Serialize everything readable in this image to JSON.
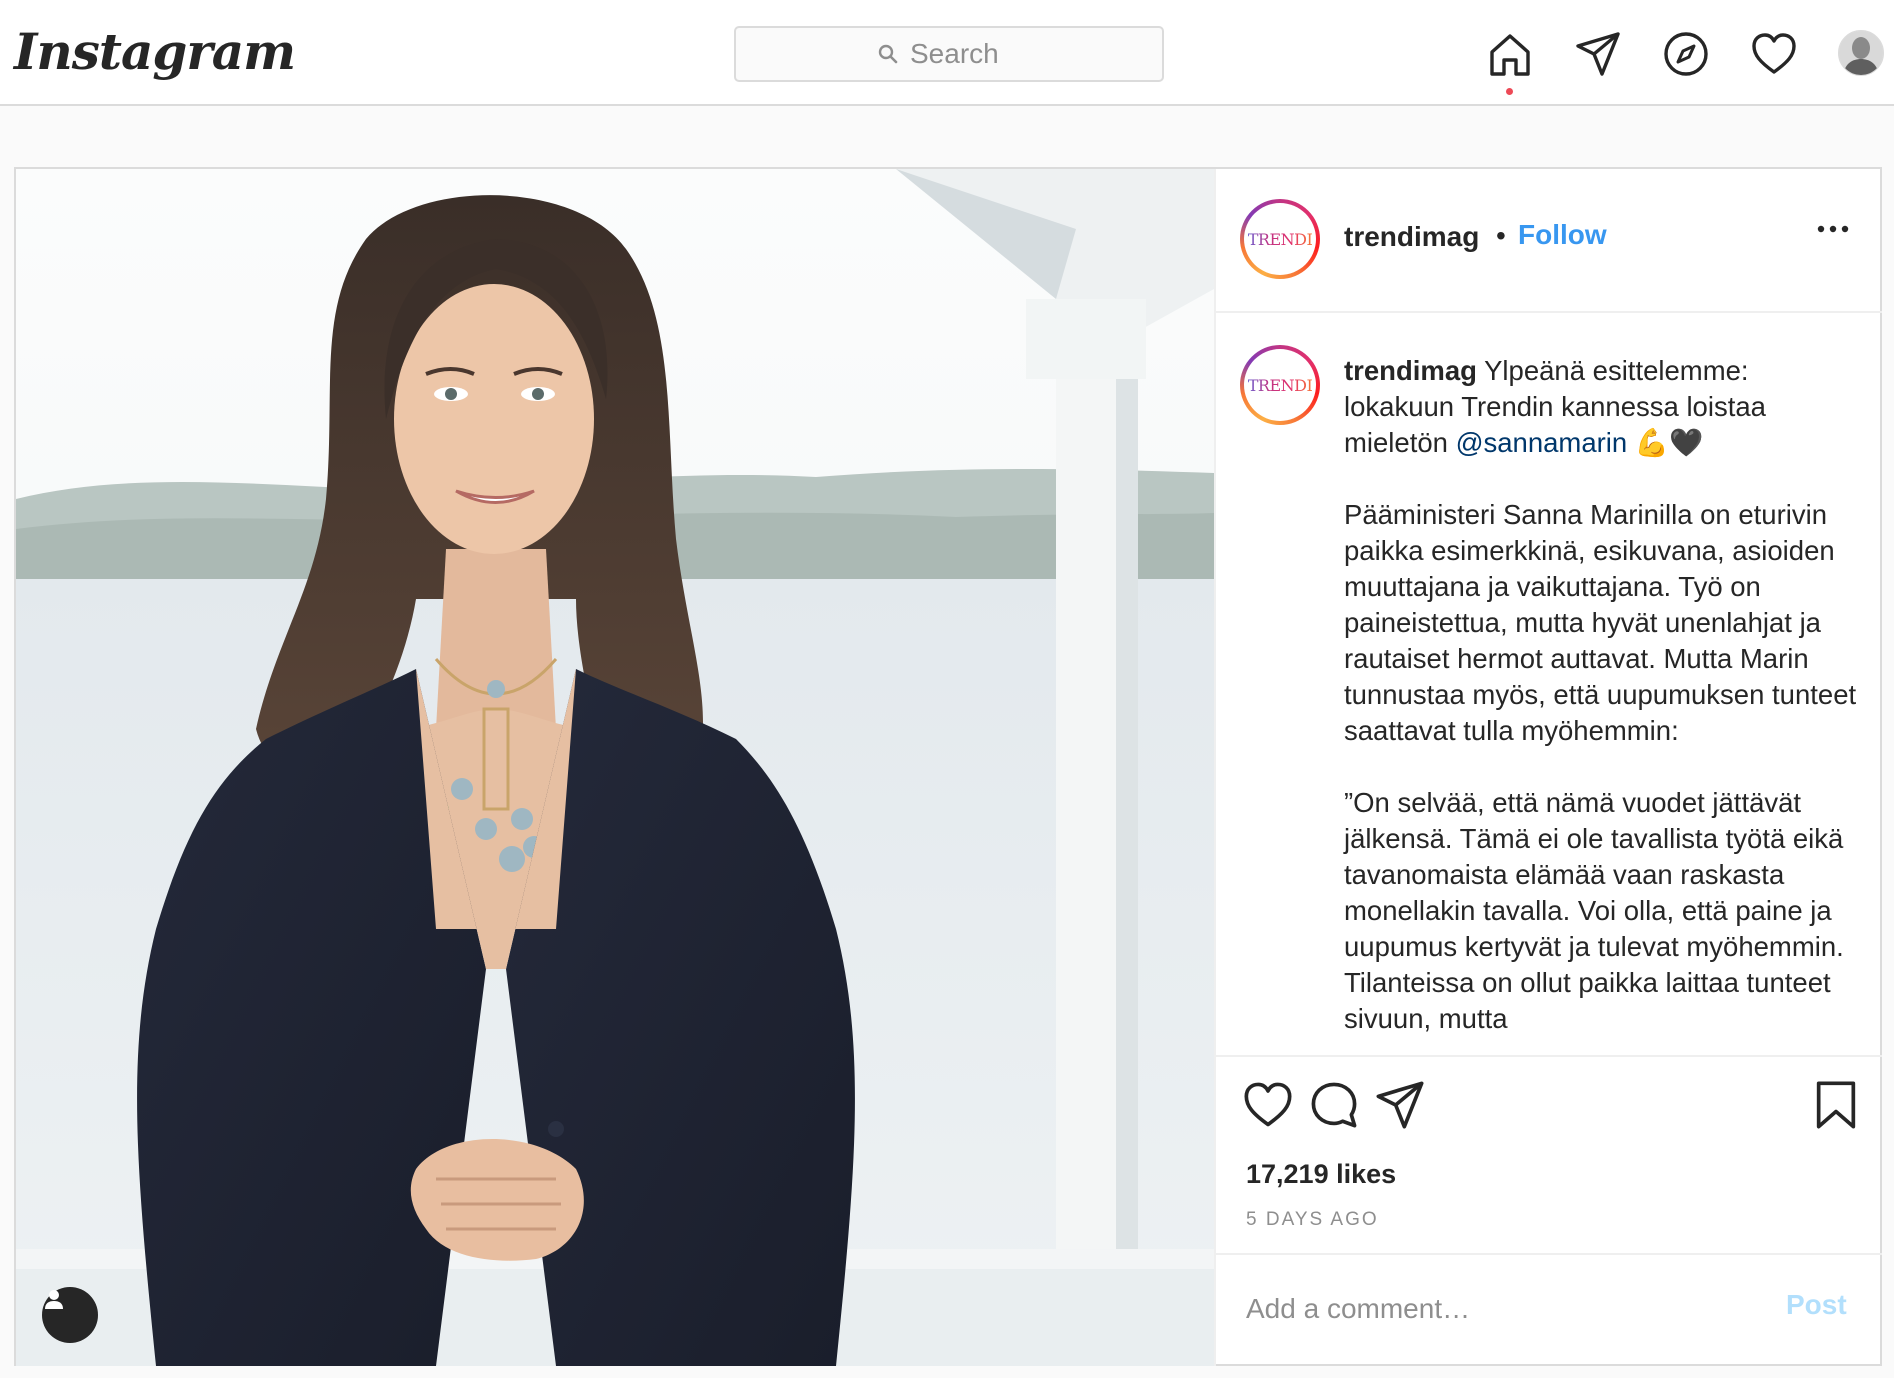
{
  "header": {
    "logo_text": "Instagram",
    "search_placeholder": "Search",
    "nav_icons": [
      "home-icon",
      "direct-message-icon",
      "explore-icon",
      "activity-heart-icon",
      "profile-avatar"
    ]
  },
  "post": {
    "author": {
      "username": "trendimag",
      "avatar_text": "TRENDI",
      "separator": "•",
      "follow_label": "Follow"
    },
    "caption": {
      "username": "trendimag",
      "line1": "Ylpeänä esittelemme: lokakuun Trendin kannessa loistaa mieletön",
      "mention": "@sannamarin",
      "emoji": "💪🖤",
      "paragraph2": "Pääministeri Sanna Marinilla on eturivin paikka esimerkkinä, esikuvana, asioiden muuttajana ja vaikuttajana. Työ on paineistettua, mutta hyvät unenlahjat ja rautaiset hermot auttavat. Mutta Marin tunnustaa myös, että uupumuksen tunteet saattavat tulla myöhemmin:",
      "paragraph3": "”On selvää, että nämä vuodet jättävät jälkensä. Tämä ei ole tavallista työtä eikä tavanomaista elämää vaan raskasta monellakin tavalla. Voi olla, että paine ja uupumus kertyvät ja tulevat myöhemmin. Tilanteissa on ollut paikka laittaa tunteet sivuun, mutta"
    },
    "likes_text": "17,219 likes",
    "time_text": "5 DAYS AGO",
    "comment_placeholder": "Add a comment…",
    "post_button": "Post",
    "colors": {
      "link_blue": "#3897f0",
      "mention_blue": "#00376b",
      "notification_red": "#ed4956",
      "post_disabled": "#b2dffc"
    }
  }
}
